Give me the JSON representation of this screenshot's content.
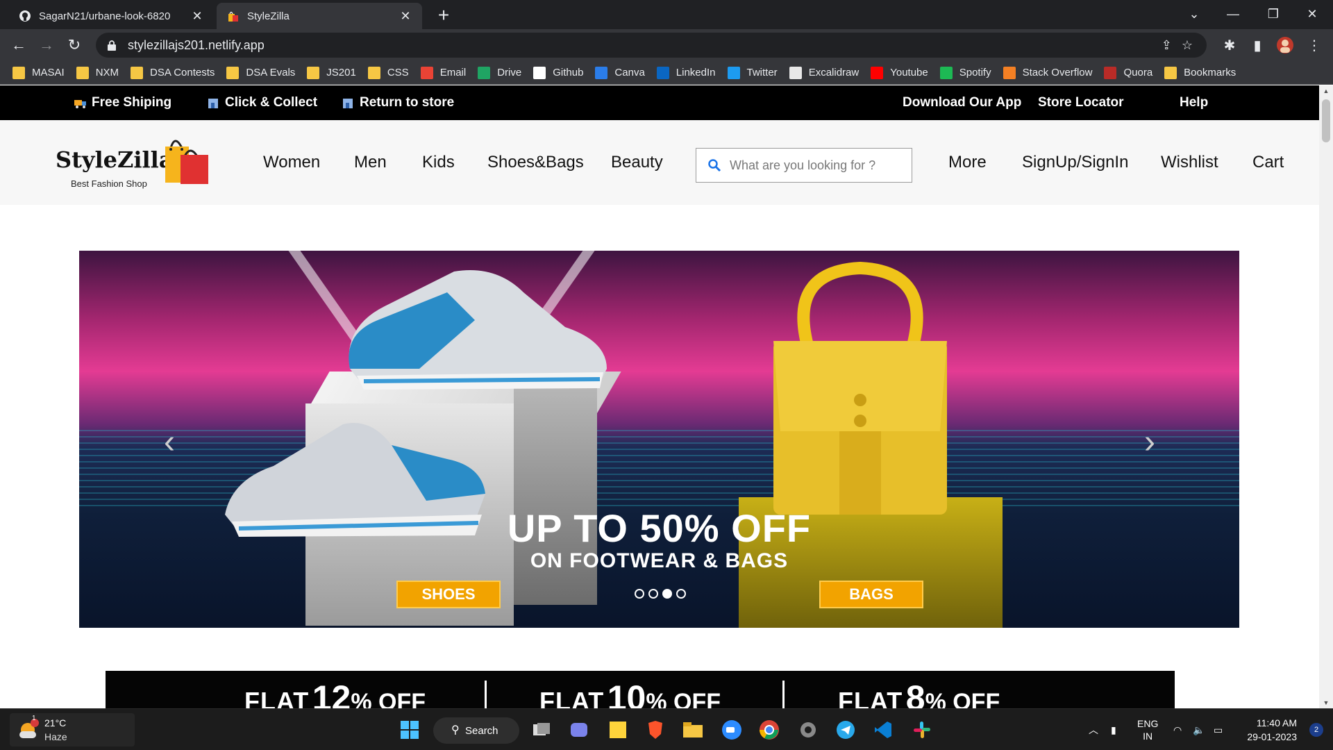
{
  "browser": {
    "tabs": [
      {
        "title": "SagarN21/urbane-look-6820",
        "icon": "github-icon",
        "active": false
      },
      {
        "title": "StyleZilla",
        "icon": "shopping-bag-icon",
        "active": true
      }
    ],
    "url": "stylezillajs201.netlify.app",
    "bookmarks": [
      {
        "label": "MASAI",
        "icon": "folder-icon",
        "color": "#f6c744"
      },
      {
        "label": "NXM",
        "icon": "folder-icon",
        "color": "#f6c744"
      },
      {
        "label": "DSA Contests",
        "icon": "folder-icon",
        "color": "#f6c744"
      },
      {
        "label": "DSA Evals",
        "icon": "folder-icon",
        "color": "#f6c744"
      },
      {
        "label": "JS201",
        "icon": "folder-icon",
        "color": "#f6c744"
      },
      {
        "label": "CSS",
        "icon": "folder-icon",
        "color": "#f6c744"
      },
      {
        "label": "Email",
        "icon": "gmail-icon",
        "color": "#ea4335"
      },
      {
        "label": "Drive",
        "icon": "drive-icon",
        "color": "#1fa463"
      },
      {
        "label": "Github",
        "icon": "github-icon",
        "color": "#ffffff"
      },
      {
        "label": "Canva",
        "icon": "canva-icon",
        "color": "#2b7de9"
      },
      {
        "label": "LinkedIn",
        "icon": "linkedin-icon",
        "color": "#0a66c2"
      },
      {
        "label": "Twitter",
        "icon": "twitter-icon",
        "color": "#1d9bf0"
      },
      {
        "label": "Excalidraw",
        "icon": "excalidraw-icon",
        "color": "#e8e8e8"
      },
      {
        "label": "Youtube",
        "icon": "youtube-icon",
        "color": "#ff0000"
      },
      {
        "label": "Spotify",
        "icon": "spotify-icon",
        "color": "#1db954"
      },
      {
        "label": "Stack Overflow",
        "icon": "stackoverflow-icon",
        "color": "#f48024"
      },
      {
        "label": "Quora",
        "icon": "quora-icon",
        "color": "#b92b27"
      },
      {
        "label": "Bookmarks",
        "icon": "folder-icon",
        "color": "#f6c744"
      }
    ]
  },
  "site": {
    "topstrip": {
      "free_shipping": "Free Shiping",
      "click_collect": "Click & Collect",
      "return_store": "Return to store",
      "download_app": "Download Our App",
      "store_locator": "Store Locator",
      "help": "Help"
    },
    "logo": {
      "name": "StyleZilla",
      "tagline": "Best Fashion Shop"
    },
    "nav": {
      "women": "Women",
      "men": "Men",
      "kids": "Kids",
      "shoes_bags": "Shoes&Bags",
      "beauty": "Beauty",
      "more": "More",
      "signin": "SignUp/SignIn",
      "wishlist": "Wishlist",
      "cart": "Cart"
    },
    "search": {
      "placeholder": "What are you looking for ?",
      "value": ""
    },
    "banner": {
      "headline": "UP TO 50% OFF",
      "subline": "ON FOOTWEAR & BAGS",
      "shoes_btn": "SHOES",
      "bags_btn": "BAGS",
      "active_slide": 3,
      "slide_count": 4
    },
    "offers": [
      {
        "flat": "FLAT",
        "num": "12",
        "rest": "% OFF"
      },
      {
        "flat": "FLAT",
        "num": "10",
        "rest": "% OFF"
      },
      {
        "flat": "FLAT",
        "num": "8",
        "rest": "% OFF"
      }
    ]
  },
  "taskbar": {
    "weather": {
      "temp": "21°C",
      "condition": "Haze",
      "badge": "1"
    },
    "search_label": "Search",
    "lang": "ENG",
    "region": "IN",
    "time": "11:40 AM",
    "date": "29-01-2023",
    "notification_count": "2"
  },
  "colors": {
    "accent_orange": "#f2a300",
    "topstrip_bg": "#000000",
    "header_bg": "#f7f7f7"
  }
}
